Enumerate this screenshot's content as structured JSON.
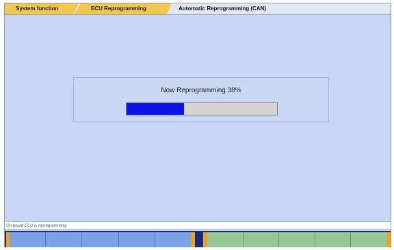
{
  "breadcrumb": [
    {
      "label": "System function"
    },
    {
      "label": "ECU Reprogramming"
    },
    {
      "label": "Automatic Reprogramming (CAN)"
    }
  ],
  "progress_dialog": {
    "message": "Now Reprogramming  38%",
    "progress_percent": 38,
    "bar_fill_color": "#0a14e6"
  },
  "status_bar": {
    "text": "On board ECU is reprogramming."
  },
  "function_keys": {
    "left_group_count": 5,
    "right_group_count": 5,
    "left_color": "#79a3e3",
    "right_color": "#98c796",
    "accent_color": "#e9a12a"
  }
}
